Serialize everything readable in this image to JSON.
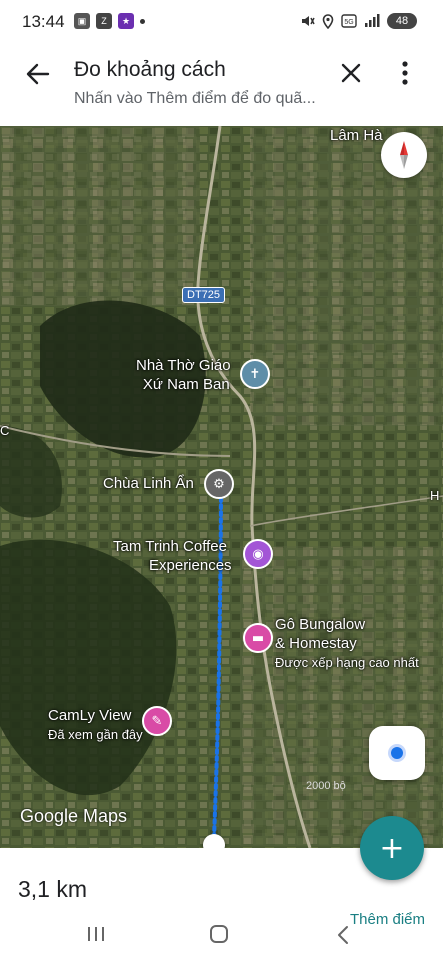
{
  "status_bar": {
    "time": "13:44",
    "battery": "48",
    "left_icons": [
      "screen-record-icon",
      "zalo-icon",
      "game-app-icon",
      "notification-dot-icon"
    ],
    "right_icons": [
      "mute-icon",
      "location-icon",
      "data-icon",
      "signal-icon",
      "battery-icon"
    ]
  },
  "app_bar": {
    "title": "Đo khoảng cách",
    "subtitle": "Nhấn vào Thêm điểm để đo quã..."
  },
  "map": {
    "labels": {
      "lam_ha": "Lâm Hà",
      "road": "DT725",
      "church_line1": "Nhà Thờ Giáo",
      "church_line2": "Xứ Nam Ban",
      "pagoda": "Chùa Linh Ẩn",
      "coffee_line1": "Tam Trinh Coffee",
      "coffee_line2": "Experiences",
      "bungalow_line1": "Gô Bungalow",
      "bungalow_line2": "& Homestay",
      "bungalow_note": "Được xếp hạng cao nhất",
      "camly": "CamLy View",
      "camly_note": "Đã xem gần đây",
      "edge_letter": "H",
      "edge_letter2": "C",
      "scale": "2000 bộ",
      "logo": "Google Maps"
    },
    "colors": {
      "measure_line": "#1a73e8",
      "church_pin": "#5f8ea8",
      "coffee_pin": "#a355d6",
      "hotel_pin": "#d94ba6",
      "camly_pin": "#d94ba6"
    }
  },
  "sheet": {
    "distance": "3,1 km",
    "add_point": "Thêm điểm",
    "fab_icon": "plus-icon"
  }
}
